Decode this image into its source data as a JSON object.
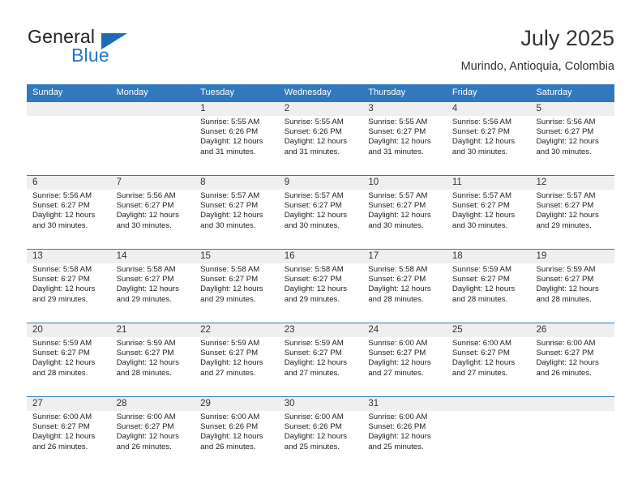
{
  "brand": {
    "name_part1": "General",
    "name_part2": "Blue",
    "logo_icon": "blue-triangle-icon"
  },
  "header": {
    "title": "July 2025",
    "location": "Murindo, Antioquia, Colombia"
  },
  "colors": {
    "header_blue": "#3079bc",
    "band_gray": "#efefef",
    "brand_blue": "#2079c4",
    "text_dark": "#333333"
  },
  "calendar": {
    "weekday_headers": [
      "Sunday",
      "Monday",
      "Tuesday",
      "Wednesday",
      "Thursday",
      "Friday",
      "Saturday"
    ],
    "weeks": [
      [
        {
          "day": "",
          "sunrise": "",
          "sunset": "",
          "daylight_line1": "",
          "daylight_line2": ""
        },
        {
          "day": "",
          "sunrise": "",
          "sunset": "",
          "daylight_line1": "",
          "daylight_line2": ""
        },
        {
          "day": "1",
          "sunrise": "Sunrise: 5:55 AM",
          "sunset": "Sunset: 6:26 PM",
          "daylight_line1": "Daylight: 12 hours",
          "daylight_line2": "and 31 minutes."
        },
        {
          "day": "2",
          "sunrise": "Sunrise: 5:55 AM",
          "sunset": "Sunset: 6:26 PM",
          "daylight_line1": "Daylight: 12 hours",
          "daylight_line2": "and 31 minutes."
        },
        {
          "day": "3",
          "sunrise": "Sunrise: 5:55 AM",
          "sunset": "Sunset: 6:27 PM",
          "daylight_line1": "Daylight: 12 hours",
          "daylight_line2": "and 31 minutes."
        },
        {
          "day": "4",
          "sunrise": "Sunrise: 5:56 AM",
          "sunset": "Sunset: 6:27 PM",
          "daylight_line1": "Daylight: 12 hours",
          "daylight_line2": "and 30 minutes."
        },
        {
          "day": "5",
          "sunrise": "Sunrise: 5:56 AM",
          "sunset": "Sunset: 6:27 PM",
          "daylight_line1": "Daylight: 12 hours",
          "daylight_line2": "and 30 minutes."
        }
      ],
      [
        {
          "day": "6",
          "sunrise": "Sunrise: 5:56 AM",
          "sunset": "Sunset: 6:27 PM",
          "daylight_line1": "Daylight: 12 hours",
          "daylight_line2": "and 30 minutes."
        },
        {
          "day": "7",
          "sunrise": "Sunrise: 5:56 AM",
          "sunset": "Sunset: 6:27 PM",
          "daylight_line1": "Daylight: 12 hours",
          "daylight_line2": "and 30 minutes."
        },
        {
          "day": "8",
          "sunrise": "Sunrise: 5:57 AM",
          "sunset": "Sunset: 6:27 PM",
          "daylight_line1": "Daylight: 12 hours",
          "daylight_line2": "and 30 minutes."
        },
        {
          "day": "9",
          "sunrise": "Sunrise: 5:57 AM",
          "sunset": "Sunset: 6:27 PM",
          "daylight_line1": "Daylight: 12 hours",
          "daylight_line2": "and 30 minutes."
        },
        {
          "day": "10",
          "sunrise": "Sunrise: 5:57 AM",
          "sunset": "Sunset: 6:27 PM",
          "daylight_line1": "Daylight: 12 hours",
          "daylight_line2": "and 30 minutes."
        },
        {
          "day": "11",
          "sunrise": "Sunrise: 5:57 AM",
          "sunset": "Sunset: 6:27 PM",
          "daylight_line1": "Daylight: 12 hours",
          "daylight_line2": "and 30 minutes."
        },
        {
          "day": "12",
          "sunrise": "Sunrise: 5:57 AM",
          "sunset": "Sunset: 6:27 PM",
          "daylight_line1": "Daylight: 12 hours",
          "daylight_line2": "and 29 minutes."
        }
      ],
      [
        {
          "day": "13",
          "sunrise": "Sunrise: 5:58 AM",
          "sunset": "Sunset: 6:27 PM",
          "daylight_line1": "Daylight: 12 hours",
          "daylight_line2": "and 29 minutes."
        },
        {
          "day": "14",
          "sunrise": "Sunrise: 5:58 AM",
          "sunset": "Sunset: 6:27 PM",
          "daylight_line1": "Daylight: 12 hours",
          "daylight_line2": "and 29 minutes."
        },
        {
          "day": "15",
          "sunrise": "Sunrise: 5:58 AM",
          "sunset": "Sunset: 6:27 PM",
          "daylight_line1": "Daylight: 12 hours",
          "daylight_line2": "and 29 minutes."
        },
        {
          "day": "16",
          "sunrise": "Sunrise: 5:58 AM",
          "sunset": "Sunset: 6:27 PM",
          "daylight_line1": "Daylight: 12 hours",
          "daylight_line2": "and 29 minutes."
        },
        {
          "day": "17",
          "sunrise": "Sunrise: 5:58 AM",
          "sunset": "Sunset: 6:27 PM",
          "daylight_line1": "Daylight: 12 hours",
          "daylight_line2": "and 28 minutes."
        },
        {
          "day": "18",
          "sunrise": "Sunrise: 5:59 AM",
          "sunset": "Sunset: 6:27 PM",
          "daylight_line1": "Daylight: 12 hours",
          "daylight_line2": "and 28 minutes."
        },
        {
          "day": "19",
          "sunrise": "Sunrise: 5:59 AM",
          "sunset": "Sunset: 6:27 PM",
          "daylight_line1": "Daylight: 12 hours",
          "daylight_line2": "and 28 minutes."
        }
      ],
      [
        {
          "day": "20",
          "sunrise": "Sunrise: 5:59 AM",
          "sunset": "Sunset: 6:27 PM",
          "daylight_line1": "Daylight: 12 hours",
          "daylight_line2": "and 28 minutes."
        },
        {
          "day": "21",
          "sunrise": "Sunrise: 5:59 AM",
          "sunset": "Sunset: 6:27 PM",
          "daylight_line1": "Daylight: 12 hours",
          "daylight_line2": "and 28 minutes."
        },
        {
          "day": "22",
          "sunrise": "Sunrise: 5:59 AM",
          "sunset": "Sunset: 6:27 PM",
          "daylight_line1": "Daylight: 12 hours",
          "daylight_line2": "and 27 minutes."
        },
        {
          "day": "23",
          "sunrise": "Sunrise: 5:59 AM",
          "sunset": "Sunset: 6:27 PM",
          "daylight_line1": "Daylight: 12 hours",
          "daylight_line2": "and 27 minutes."
        },
        {
          "day": "24",
          "sunrise": "Sunrise: 6:00 AM",
          "sunset": "Sunset: 6:27 PM",
          "daylight_line1": "Daylight: 12 hours",
          "daylight_line2": "and 27 minutes."
        },
        {
          "day": "25",
          "sunrise": "Sunrise: 6:00 AM",
          "sunset": "Sunset: 6:27 PM",
          "daylight_line1": "Daylight: 12 hours",
          "daylight_line2": "and 27 minutes."
        },
        {
          "day": "26",
          "sunrise": "Sunrise: 6:00 AM",
          "sunset": "Sunset: 6:27 PM",
          "daylight_line1": "Daylight: 12 hours",
          "daylight_line2": "and 26 minutes."
        }
      ],
      [
        {
          "day": "27",
          "sunrise": "Sunrise: 6:00 AM",
          "sunset": "Sunset: 6:27 PM",
          "daylight_line1": "Daylight: 12 hours",
          "daylight_line2": "and 26 minutes."
        },
        {
          "day": "28",
          "sunrise": "Sunrise: 6:00 AM",
          "sunset": "Sunset: 6:27 PM",
          "daylight_line1": "Daylight: 12 hours",
          "daylight_line2": "and 26 minutes."
        },
        {
          "day": "29",
          "sunrise": "Sunrise: 6:00 AM",
          "sunset": "Sunset: 6:26 PM",
          "daylight_line1": "Daylight: 12 hours",
          "daylight_line2": "and 26 minutes."
        },
        {
          "day": "30",
          "sunrise": "Sunrise: 6:00 AM",
          "sunset": "Sunset: 6:26 PM",
          "daylight_line1": "Daylight: 12 hours",
          "daylight_line2": "and 25 minutes."
        },
        {
          "day": "31",
          "sunrise": "Sunrise: 6:00 AM",
          "sunset": "Sunset: 6:26 PM",
          "daylight_line1": "Daylight: 12 hours",
          "daylight_line2": "and 25 minutes."
        },
        {
          "day": "",
          "sunrise": "",
          "sunset": "",
          "daylight_line1": "",
          "daylight_line2": ""
        },
        {
          "day": "",
          "sunrise": "",
          "sunset": "",
          "daylight_line1": "",
          "daylight_line2": ""
        }
      ]
    ]
  }
}
